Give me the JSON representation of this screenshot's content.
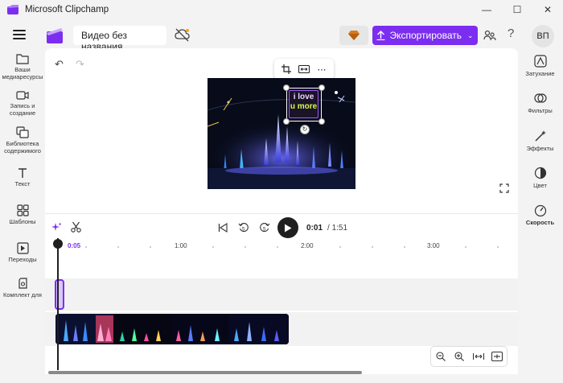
{
  "window": {
    "title": "Microsoft Clipchamp",
    "minimize": "—",
    "maximize": "☐",
    "close": "✕"
  },
  "header": {
    "project_title": "Видео без названия",
    "export_label": "Экспортировать",
    "help": "?",
    "avatar_initials": "ВП"
  },
  "left_sidebar": {
    "items": [
      {
        "label": "Ваши медиаресурсы",
        "icon": "folder-icon"
      },
      {
        "label": "Запись и создание",
        "icon": "camera-icon"
      },
      {
        "label": "Библиотека содержимого",
        "icon": "library-icon"
      },
      {
        "label": "Текст",
        "icon": "text-icon"
      },
      {
        "label": "Шаблоны",
        "icon": "templates-icon"
      },
      {
        "label": "Переходы",
        "icon": "transitions-icon"
      },
      {
        "label": "Комплект для",
        "icon": "brand-kit-icon"
      }
    ]
  },
  "right_sidebar": {
    "items": [
      {
        "label": "Затухание",
        "icon": "fade-icon"
      },
      {
        "label": "Фильтры",
        "icon": "filters-icon"
      },
      {
        "label": "Эффекты",
        "icon": "effects-icon"
      },
      {
        "label": "Цвет",
        "icon": "color-icon"
      },
      {
        "label": "Скорость",
        "icon": "speed-icon"
      }
    ]
  },
  "preview": {
    "overlay_line1": "i love",
    "overlay_line2": "u more"
  },
  "playback": {
    "current_time": "0:01",
    "total_time": "/ 1:51"
  },
  "timeline": {
    "playhead_time": "0:05",
    "ruler_labels": [
      "1:00",
      "2:00",
      "3:00"
    ]
  },
  "colors": {
    "accent": "#7b2ef0",
    "background": "#f3f3f3"
  }
}
